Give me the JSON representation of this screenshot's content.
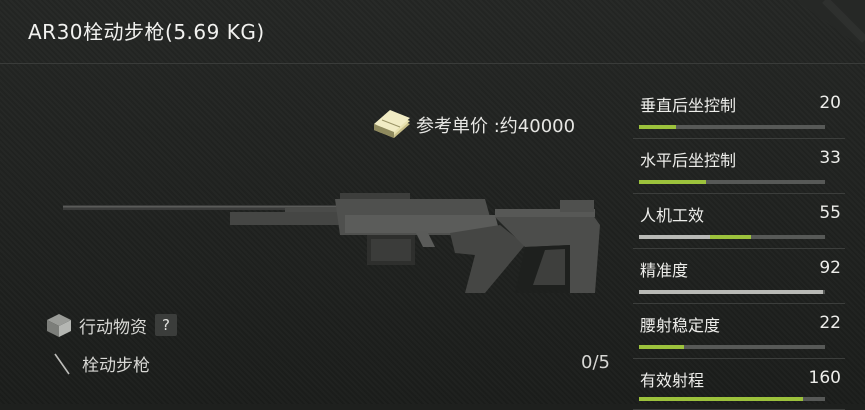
{
  "title": "AR30栓动步枪(5.69 KG)",
  "price": {
    "label": "参考单价 :约40000",
    "icon": "cash-stack-icon"
  },
  "category": {
    "label": "行动物资",
    "help": "?",
    "icon": "box-icon"
  },
  "subtype": {
    "label": "栓动步枪",
    "icon": "slash-icon"
  },
  "ammo": "0/5",
  "colors": {
    "bar_green": "#9cc23c",
    "bar_track": "#575957",
    "bar_pale": "#b9bab6",
    "background": "#1e201e"
  },
  "stats": [
    {
      "label": "垂直后坐控制",
      "value": "20",
      "fill": 0.2,
      "fill_color": "#9cc23c",
      "base": 0
    },
    {
      "label": "水平后坐控制",
      "value": "33",
      "fill": 0.36,
      "fill_color": "#9cc23c",
      "base": 0
    },
    {
      "label": "人机工效",
      "value": "55",
      "fill": 0.6,
      "fill_color": "#9cc23c",
      "base": 0.38
    },
    {
      "label": "精准度",
      "value": "92",
      "fill": 0.99,
      "fill_color": "#b9bab6",
      "base": 0
    },
    {
      "label": "腰射稳定度",
      "value": "22",
      "fill": 0.24,
      "fill_color": "#9cc23c",
      "base": 0
    },
    {
      "label": "有效射程",
      "value": "160",
      "fill": 0.88,
      "fill_color": "#9cc23c",
      "base": 0
    }
  ]
}
